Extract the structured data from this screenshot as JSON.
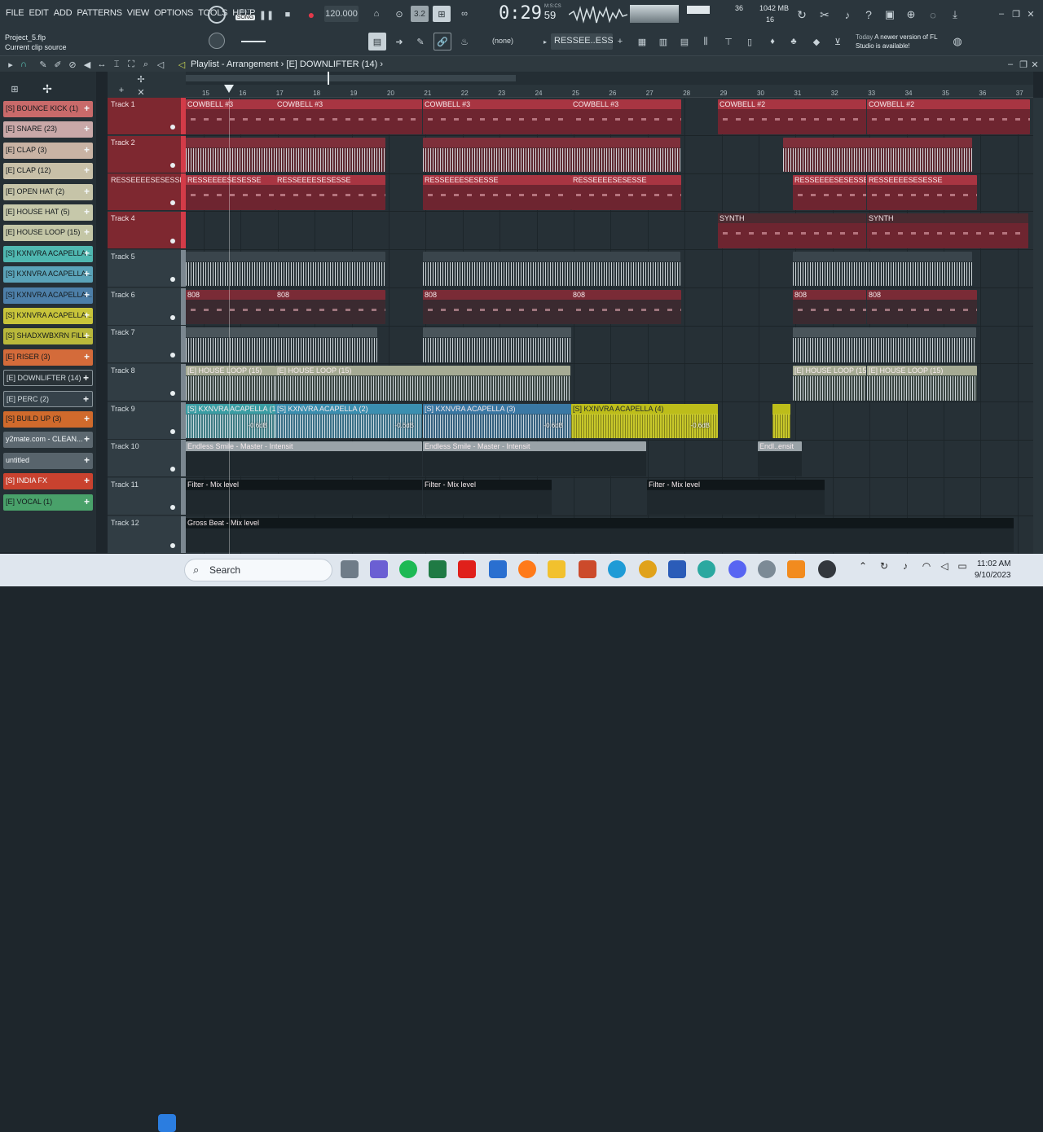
{
  "menu": [
    "FILE",
    "EDIT",
    "ADD",
    "PATTERNS",
    "VIEW",
    "OPTIONS",
    "TOOLS",
    "HELP"
  ],
  "transport": {
    "pat_label": "PAT",
    "song_label": "SONG",
    "tempo": "120.000",
    "time": "0:29",
    "time_small": "59",
    "time_unit": "M:S:CS"
  },
  "monitor": {
    "cpu": "36",
    "memory": "1042 MB",
    "poly": "16"
  },
  "project": {
    "name": "Project_5.flp",
    "hint": "Current clip source"
  },
  "pattern_selector": {
    "none_label": "(none)",
    "pattern_name": "RESSEE..ESSE"
  },
  "update_notice": {
    "when": "Today",
    "text": "A newer version of FL Studio is available!"
  },
  "breadcrumb": {
    "part1": "Playlist - Arrangement",
    "part2": "[E] DOWNLIFTER (14)"
  },
  "channels": [
    {
      "label": "[S] BOUNCE KICK (1)",
      "color": "#c96a6a"
    },
    {
      "label": "[E] SNARE (23)",
      "color": "#c9a8a8"
    },
    {
      "label": "[E] CLAP (3)",
      "color": "#c9b3a4"
    },
    {
      "label": "[E] CLAP (12)",
      "color": "#c8c0a8"
    },
    {
      "label": "[E] OPEN HAT (2)",
      "color": "#c6c4a8"
    },
    {
      "label": "[E] HOUSE HAT (5)",
      "color": "#c6c8aa"
    },
    {
      "label": "[E] HOUSE LOOP (15)",
      "color": "#c4c6a6"
    },
    {
      "label": "[S] KXNVRA ACAPELLA...",
      "color": "#4fb7b0"
    },
    {
      "label": "[S] KXNVRA ACAPELLA...",
      "color": "#5aa3b8"
    },
    {
      "label": "[S] KXNVRA ACAPELLA...",
      "color": "#4d7fa8"
    },
    {
      "label": "[S] KXNVRA ACAPELLA...",
      "color": "#c8c43a"
    },
    {
      "label": "[S] SHADXWBXRN FILL...",
      "color": "#b9b83b"
    },
    {
      "label": "[E] RISER (3)",
      "color": "#d46b3a"
    },
    {
      "label": "[E] DOWNLIFTER (14)",
      "color": "#2a3338"
    },
    {
      "label": "[E] PERC (2)",
      "color": "#36424a"
    },
    {
      "label": "[S] BUILD UP (3)",
      "color": "#d06a2c"
    },
    {
      "label": "y2mate.com - CLEAN...",
      "color": "#5c6870"
    },
    {
      "label": "untitled",
      "color": "#58646c"
    },
    {
      "label": "[S] INDIA FX",
      "color": "#c9422f"
    },
    {
      "label": "[E] VOCAL (1)",
      "color": "#49a16a"
    }
  ],
  "tracks": [
    {
      "label": "Track 1",
      "style": "red"
    },
    {
      "label": "Track 2",
      "style": "red"
    },
    {
      "label": "RESSEEEESESESSE",
      "style": "red"
    },
    {
      "label": "Track 4",
      "style": "red"
    },
    {
      "label": "Track 5",
      "style": "plain"
    },
    {
      "label": "Track 6",
      "style": "plain"
    },
    {
      "label": "Track 7",
      "style": "plain"
    },
    {
      "label": "Track 8",
      "style": "plain"
    },
    {
      "label": "Track 9",
      "style": "plain"
    },
    {
      "label": "Track 10",
      "style": "plain"
    },
    {
      "label": "Track 11",
      "style": "plain"
    },
    {
      "label": "Track 12",
      "style": "plain"
    }
  ],
  "bars": [
    "15",
    "16",
    "17",
    "18",
    "19",
    "20",
    "21",
    "22",
    "23",
    "24",
    "25",
    "26",
    "27",
    "28",
    "29",
    "30",
    "31",
    "32",
    "33",
    "34",
    "35",
    "36",
    "37"
  ],
  "clips": {
    "cowbell3": "COWBELL #3",
    "cowbell2": "COWBELL #2",
    "resse": "RESSEEEESESESSE",
    "synth": "SYNTH",
    "b808": "808",
    "houseloop": "[E] HOUSE LOOP (15)",
    "acap1": "[S] KXNVRA ACAPELLA (1)",
    "acap2": "[S] KXNVRA ACAPELLA (2)",
    "acap3": "[S] KXNVRA ACAPELLA (3)",
    "acap4": "[S] KXNVRA ACAPELLA (4)",
    "db": "-0.6dB",
    "auto1": "Endless Smile - Master - Intensit",
    "auto1b": "Endl..ensit",
    "auto2": "Filter - Mix level",
    "auto3": "Gross Beat - Mix level"
  },
  "taskbar": {
    "search": "Search",
    "time": "11:02 AM",
    "date": "9/10/2023"
  }
}
